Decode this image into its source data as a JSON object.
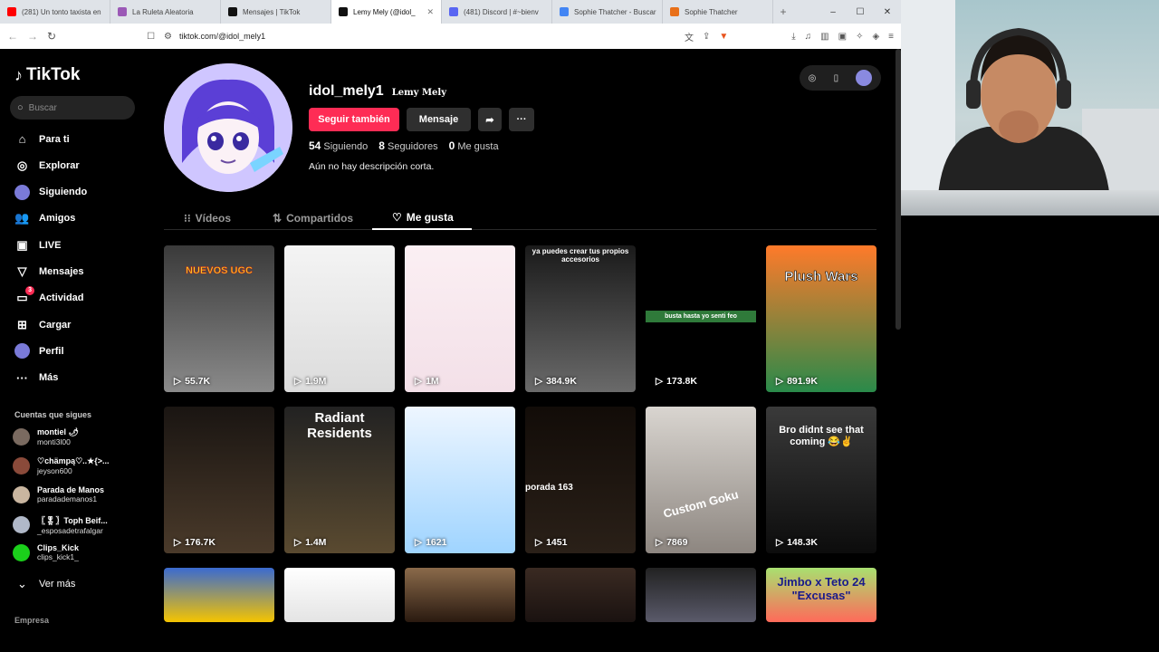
{
  "browser": {
    "tabs": [
      {
        "label": "(281) Un tonto taxista en",
        "color": "#ff0000",
        "active": false
      },
      {
        "label": "La Ruleta Aleatoria",
        "color": "#9b59b6",
        "active": false
      },
      {
        "label": "Mensajes | TikTok",
        "color": "#111111",
        "active": false
      },
      {
        "label": "Lemy Mely (@idol_",
        "color": "#111111",
        "active": true
      },
      {
        "label": "(481) Discord | #~bienv",
        "color": "#5865f2",
        "active": false
      },
      {
        "label": "Sophie Thatcher - Buscar",
        "color": "#4285f4",
        "active": false
      },
      {
        "label": "Sophie Thatcher",
        "color": "#e8701a",
        "active": false
      }
    ],
    "url": "tiktok.com/@idol_mely1"
  },
  "sidebar": {
    "logo": "TikTok",
    "search_placeholder": "Buscar",
    "nav": [
      {
        "label": "Para ti",
        "icon": "home-icon"
      },
      {
        "label": "Explorar",
        "icon": "compass-icon"
      },
      {
        "label": "Siguiendo",
        "icon": "following-avatar-icon"
      },
      {
        "label": "Amigos",
        "icon": "friends-icon"
      },
      {
        "label": "LIVE",
        "icon": "live-icon"
      },
      {
        "label": "Mensajes",
        "icon": "send-icon"
      },
      {
        "label": "Actividad",
        "icon": "activity-icon",
        "badge": "3"
      },
      {
        "label": "Cargar",
        "icon": "upload-icon"
      },
      {
        "label": "Perfil",
        "icon": "profile-avatar-icon"
      },
      {
        "label": "Más",
        "icon": "more-icon"
      }
    ],
    "following_title": "Cuentas que sigues",
    "following": [
      {
        "name": "montiel 🌶",
        "handle": "monti3l00",
        "color": "#7a6a60"
      },
      {
        "name": "♡chämpą♡..★{>...",
        "handle": "jeyson600",
        "color": "#8a4a3a"
      },
      {
        "name": "Parada de Manos",
        "handle": "paradademanos1",
        "color": "#c9b6a0"
      },
      {
        "name": "〖🎖〗Toph Beif...",
        "handle": "_esposadetrafalgar",
        "color": "#b0b8c8"
      },
      {
        "name": "Clips_Kick",
        "handle": "clips_kick1_",
        "color": "#1bd01b"
      }
    ],
    "see_more": "Ver más",
    "footer": "Empresa"
  },
  "profile": {
    "username": "idol_mely1",
    "nickname": "Lemy Mely",
    "follow_button": "Seguir también",
    "message_button": "Mensaje",
    "following_count": "54",
    "following_label": "Siguiendo",
    "followers_count": "8",
    "followers_label": "Seguidores",
    "likes_count": "0",
    "likes_label": "Me gusta",
    "bio": "Aún no hay descripción corta."
  },
  "tabs": [
    {
      "label": "Vídeos",
      "icon": "grid-icon"
    },
    {
      "label": "Compartidos",
      "icon": "repost-icon"
    },
    {
      "label": "Me gusta",
      "icon": "heart-icon",
      "selected": true
    }
  ],
  "videos": [
    {
      "views": "55.7K",
      "caption": "NUEVOS UGC",
      "bg": "linear-gradient(#3a3a3a,#8a8a8a)"
    },
    {
      "views": "1.9M",
      "caption": "",
      "bg": "linear-gradient(#f4f4f4,#dcdcdc)"
    },
    {
      "views": "1M",
      "caption": "",
      "bg": "linear-gradient(#fbeff3,#f3e0e8)"
    },
    {
      "views": "384.9K",
      "caption": "ya puedes crear tus propios accesorios",
      "bg": "linear-gradient(#1a1a1a,#6a6a6a)"
    },
    {
      "views": "173.8K",
      "caption": "busta hasta yo senti feo",
      "bg": "linear-gradient(#000,#000)"
    },
    {
      "views": "891.9K",
      "caption": "Plush Wars",
      "bg": "linear-gradient(#ff7a2a,#2a8a4a)"
    },
    {
      "views": "176.7K",
      "caption": "",
      "bg": "linear-gradient(#1a1512,#4a3a2a)"
    },
    {
      "views": "1.4M",
      "caption": "Radiant Residents",
      "bg": "linear-gradient(#222,#5a4a30)"
    },
    {
      "views": "1621",
      "caption": "",
      "bg": "linear-gradient(#eef6ff,#9fd4ff)"
    },
    {
      "views": "1451",
      "caption": "porada 163",
      "bg": "linear-gradient(#120c08,#2a2018)"
    },
    {
      "views": "7869",
      "caption": "Custom Goku",
      "bg": "linear-gradient(#d9d5d0,#8d8680)"
    },
    {
      "views": "148.3K",
      "caption": "Bro didnt see that coming 😂✌",
      "bg": "linear-gradient(#3a3a3a,#0c0c0c)"
    },
    {
      "views": "",
      "caption": "",
      "bg": "linear-gradient(#3a6ad0,#f5c400)"
    },
    {
      "views": "",
      "caption": "",
      "bg": "linear-gradient(#fff,#e4e4e4)"
    },
    {
      "views": "",
      "caption": "",
      "bg": "linear-gradient(#8a6a4a,#2a1a10)"
    },
    {
      "views": "",
      "caption": "",
      "bg": "linear-gradient(#3a2a22,#1a1210)"
    },
    {
      "views": "",
      "caption": "",
      "bg": "linear-gradient(#222,#5a5a6a)"
    },
    {
      "views": "",
      "caption": "Jimbo x Teto 24 \"Excusas\"",
      "bg": "linear-gradient(#a8e070,#ff6a5a)"
    }
  ],
  "colors": {
    "accent": "#fe2c55",
    "surface": "#2f2f2f"
  }
}
